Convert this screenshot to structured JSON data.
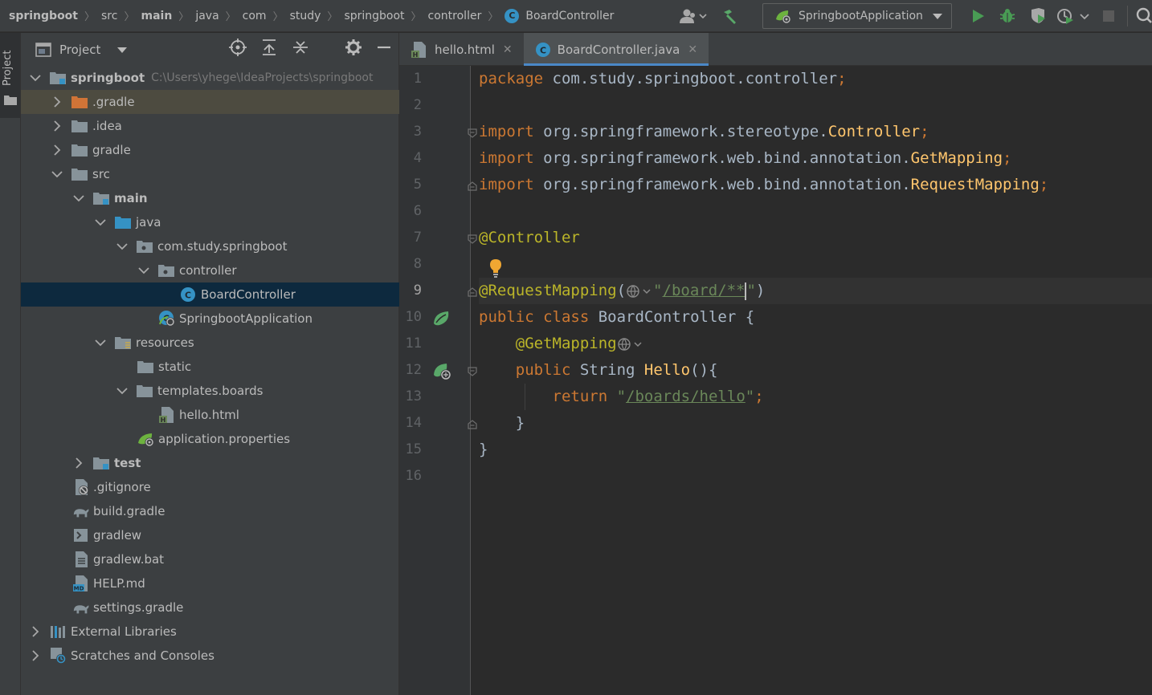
{
  "breadcrumbs": [
    {
      "label": "springboot",
      "bold": true
    },
    {
      "label": "src"
    },
    {
      "label": "main",
      "bold": true
    },
    {
      "label": "java"
    },
    {
      "label": "com"
    },
    {
      "label": "study"
    },
    {
      "label": "springboot"
    },
    {
      "label": "controller"
    },
    {
      "label": "BoardController",
      "icon": "class-icon"
    }
  ],
  "toolbar": {
    "run_config_label": "SpringbootApplication"
  },
  "stripe": {
    "project_label": "Project"
  },
  "project_panel": {
    "title": "Project",
    "root_label": "springboot",
    "root_path": "C:\\Users\\yhege\\IdeaProjects\\springboot",
    "items": [
      {
        "label": ".gradle"
      },
      {
        "label": ".idea"
      },
      {
        "label": "gradle"
      },
      {
        "label": "src"
      },
      {
        "label": "main"
      },
      {
        "label": "java"
      },
      {
        "label": "com.study.springboot"
      },
      {
        "label": "controller"
      },
      {
        "label": "BoardController"
      },
      {
        "label": "SpringbootApplication"
      },
      {
        "label": "resources"
      },
      {
        "label": "static"
      },
      {
        "label": "templates.boards"
      },
      {
        "label": "hello.html"
      },
      {
        "label": "application.properties"
      },
      {
        "label": "test"
      },
      {
        "label": ".gitignore"
      },
      {
        "label": "build.gradle"
      },
      {
        "label": "gradlew"
      },
      {
        "label": "gradlew.bat"
      },
      {
        "label": "HELP.md"
      },
      {
        "label": "settings.gradle"
      },
      {
        "label": "External Libraries"
      },
      {
        "label": "Scratches and Consoles"
      }
    ]
  },
  "editor_tabs": [
    {
      "label": "hello.html",
      "active": false
    },
    {
      "label": "BoardController.java",
      "active": true
    }
  ],
  "editor": {
    "line_numbers": [
      "1",
      "2",
      "3",
      "4",
      "5",
      "6",
      "7",
      "8",
      "9",
      "10",
      "11",
      "12",
      "13",
      "14",
      "15",
      "16"
    ],
    "code": {
      "l1_kw": "package",
      "l1_rest": " com.study.springboot.controller",
      "l1_semi": ";",
      "import_kw": "import",
      "l3_pkg": " org.springframework.stereotype.",
      "l3_cls": "Controller",
      "l4_pkg": " org.springframework.web.bind.annotation.",
      "l4_cls": "GetMapping",
      "l5_pkg": " org.springframework.web.bind.annotation.",
      "l5_cls": "RequestMapping",
      "semi": ";",
      "l7_ann": "@Controller",
      "l9_ann": "@RequestMapping",
      "l9_open": "(",
      "l9_q1": "\"",
      "l9_path": "/board/**",
      "l9_q2": "\"",
      "l9_close": ")",
      "l10_public": "public",
      "l10_class": " class",
      "l10_name": " BoardController {",
      "l11_ann": "@GetMapping",
      "l12_public": "public",
      "l12_type": " String ",
      "l12_fn": "Hello",
      "l12_rest": "(){",
      "l13_return": "return",
      "l13_q1": " \"",
      "l13_path": "/boards/hello",
      "l13_q2": "\"",
      "l13_semi": ";",
      "l14": "}",
      "l15": "}"
    }
  },
  "colors": {
    "keyword": "#cc7832",
    "annotation": "#bbb529",
    "string": "#6a8759",
    "function": "#ffc66d",
    "accent": "#4a88c7"
  }
}
